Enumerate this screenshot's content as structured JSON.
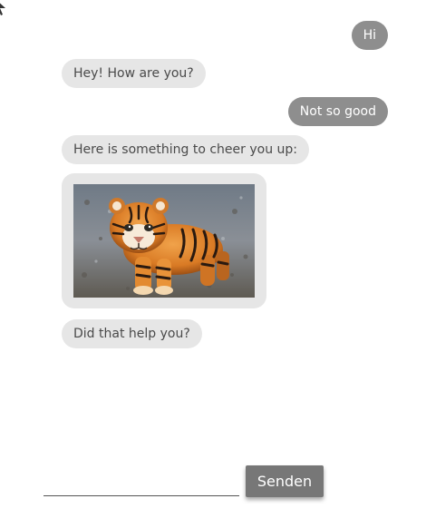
{
  "messages": [
    {
      "from": "user",
      "text": "Hi"
    },
    {
      "from": "bot",
      "text": "Hey! How are you?"
    },
    {
      "from": "user",
      "text": "Not so good"
    },
    {
      "from": "bot",
      "text": "Here is something to cheer you up:"
    },
    {
      "from": "bot",
      "type": "image",
      "icon": "tiger-cub-photo"
    },
    {
      "from": "bot",
      "text": "Did that help you?"
    }
  ],
  "composer": {
    "input_value": "",
    "send_label": "Senden"
  },
  "colors": {
    "user_bubble": "#8e8e8e",
    "bot_bubble": "#e6e6e6",
    "send_button": "#777777"
  }
}
